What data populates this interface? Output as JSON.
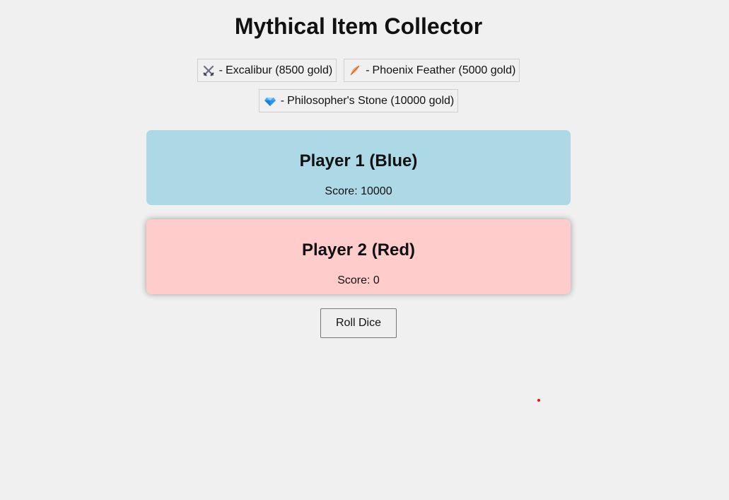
{
  "title": "Mythical Item Collector",
  "items": [
    {
      "icon": "crossed-swords-icon",
      "name": "Excalibur",
      "value_text": "(8500 gold)",
      "gold": 8500
    },
    {
      "icon": "feather-icon",
      "name": "Phoenix Feather",
      "value_text": "(5000 gold)",
      "gold": 5000
    },
    {
      "icon": "gem-icon",
      "name": "Philosopher's Stone",
      "value_text": "(10000 gold)",
      "gold": 10000
    }
  ],
  "separator": "-",
  "players": [
    {
      "name": "Player 1 (Blue)",
      "score_text": "Score: 10000",
      "color": "#add8e6"
    },
    {
      "name": "Player 2 (Red)",
      "score_text": "Score: 0",
      "color": "#ffcccc"
    }
  ],
  "roll_button_label": "Roll Dice",
  "marker_color": "#e81123"
}
